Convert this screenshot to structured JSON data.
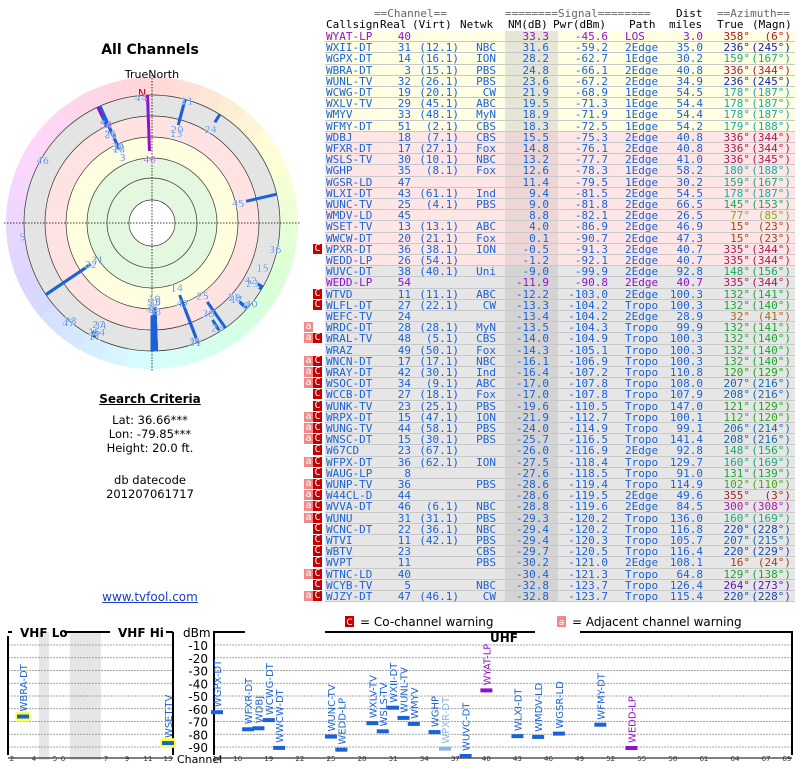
{
  "title": "All Channels",
  "polar": {
    "north_label": "TrueNorth",
    "n_marker": "N"
  },
  "search": {
    "title": "Search Criteria",
    "lat": "Lat: 36.66***",
    "lon": "Lon: -79.85***",
    "height": "Height: 20.0 ft.",
    "db_label": "db datecode",
    "db_code": "201207061717",
    "link": "www.tvfool.com"
  },
  "table": {
    "group_channel": "==Channel==",
    "group_signal": "========Signal========",
    "group_dist": "Dist",
    "group_azimuth": "==Azimuth==",
    "h_callsign": "Callsign",
    "h_real": "Real",
    "h_virt": "(Virt)",
    "h_netwk": "Netwk",
    "h_nm": "NM(dB)",
    "h_pwr": "Pwr(dBm)",
    "h_path": "Path",
    "h_dist": "miles",
    "h_true": "True",
    "h_magn": "(Magn)"
  },
  "colors": {
    "station": "#1a62d6",
    "highlight": "#9010d0",
    "cochannel": "#c40000",
    "adjacent": "#f08a8a"
  },
  "rows": [
    {
      "callsign": "WYAT-LP",
      "real": "40",
      "virt": "",
      "netwk": "",
      "nm": "33.3",
      "pwr": "-45.6",
      "path": "LOS",
      "dist": "3.0",
      "az_true": "358°",
      "az_magn": "(6°)",
      "warn": "",
      "color": "#9010d0"
    },
    {
      "callsign": "WXII-DT",
      "real": "31",
      "virt": "(12.1)",
      "netwk": "NBC",
      "nm": "31.6",
      "pwr": "-59.2",
      "path": "2Edge",
      "dist": "35.0",
      "az_true": "236°",
      "az_magn": "(245°)",
      "warn": ""
    },
    {
      "callsign": "WGPX-DT",
      "real": "14",
      "virt": "(16.1)",
      "netwk": "ION",
      "nm": "28.2",
      "pwr": "-62.7",
      "path": "1Edge",
      "dist": "30.2",
      "az_true": "159°",
      "az_magn": "(167°)",
      "warn": ""
    },
    {
      "callsign": "WBRA-DT",
      "real": "3",
      "virt": "(15.1)",
      "netwk": "PBS",
      "nm": "24.8",
      "pwr": "-66.1",
      "path": "2Edge",
      "dist": "40.8",
      "az_true": "336°",
      "az_magn": "(344°)",
      "warn": ""
    },
    {
      "callsign": "WUNL-TV",
      "real": "32",
      "virt": "(26.1)",
      "netwk": "PBS",
      "nm": "23.6",
      "pwr": "-67.2",
      "path": "2Edge",
      "dist": "34.9",
      "az_true": "236°",
      "az_magn": "(245°)",
      "warn": ""
    },
    {
      "callsign": "WCWG-DT",
      "real": "19",
      "virt": "(20.1)",
      "netwk": "CW",
      "nm": "21.9",
      "pwr": "-68.9",
      "path": "1Edge",
      "dist": "54.5",
      "az_true": "178°",
      "az_magn": "(187°)",
      "warn": ""
    },
    {
      "callsign": "WXLV-TV",
      "real": "29",
      "virt": "(45.1)",
      "netwk": "ABC",
      "nm": "19.5",
      "pwr": "-71.3",
      "path": "1Edge",
      "dist": "54.4",
      "az_true": "178°",
      "az_magn": "(187°)",
      "warn": ""
    },
    {
      "callsign": "WMYV",
      "real": "33",
      "virt": "(48.1)",
      "netwk": "MyN",
      "nm": "18.9",
      "pwr": "-71.9",
      "path": "1Edge",
      "dist": "54.4",
      "az_true": "178°",
      "az_magn": "(187°)",
      "warn": ""
    },
    {
      "callsign": "WFMY-DT",
      "real": "51",
      "virt": "(2.1)",
      "netwk": "CBS",
      "nm": "18.3",
      "pwr": "-72.5",
      "path": "1Edge",
      "dist": "54.2",
      "az_true": "179°",
      "az_magn": "(188°)",
      "warn": ""
    },
    {
      "callsign": "WDBJ",
      "real": "18",
      "virt": "(7.1)",
      "netwk": "CBS",
      "nm": "15.5",
      "pwr": "-75.3",
      "path": "2Edge",
      "dist": "40.8",
      "az_true": "336°",
      "az_magn": "(344°)",
      "warn": ""
    },
    {
      "callsign": "WFXR-DT",
      "real": "17",
      "virt": "(27.1)",
      "netwk": "Fox",
      "nm": "14.8",
      "pwr": "-76.1",
      "path": "2Edge",
      "dist": "40.8",
      "az_true": "336°",
      "az_magn": "(344°)",
      "warn": ""
    },
    {
      "callsign": "WSLS-TV",
      "real": "30",
      "virt": "(10.1)",
      "netwk": "NBC",
      "nm": "13.2",
      "pwr": "-77.7",
      "path": "2Edge",
      "dist": "41.0",
      "az_true": "336°",
      "az_magn": "(345°)",
      "warn": ""
    },
    {
      "callsign": "WGHP",
      "real": "35",
      "virt": "(8.1)",
      "netwk": "Fox",
      "nm": "12.6",
      "pwr": "-78.3",
      "path": "1Edge",
      "dist": "58.2",
      "az_true": "180°",
      "az_magn": "(188°)",
      "warn": ""
    },
    {
      "callsign": "WGSR-LD",
      "real": "47",
      "virt": "",
      "netwk": "",
      "nm": "11.4",
      "pwr": "-79.5",
      "path": "1Edge",
      "dist": "30.2",
      "az_true": "159°",
      "az_magn": "(167°)",
      "warn": ""
    },
    {
      "callsign": "WLXI-DT",
      "real": "43",
      "virt": "(61.1)",
      "netwk": "Ind",
      "nm": "9.4",
      "pwr": "-81.5",
      "path": "2Edge",
      "dist": "54.5",
      "az_true": "178°",
      "az_magn": "(187°)",
      "warn": ""
    },
    {
      "callsign": "WUNC-TV",
      "real": "25",
      "virt": "(4.1)",
      "netwk": "PBS",
      "nm": "9.0",
      "pwr": "-81.8",
      "path": "2Edge",
      "dist": "66.5",
      "az_true": "145°",
      "az_magn": "(153°)",
      "warn": ""
    },
    {
      "callsign": "WMDV-LD",
      "real": "45",
      "virt": "",
      "netwk": "",
      "nm": "8.8",
      "pwr": "-82.1",
      "path": "2Edge",
      "dist": "26.5",
      "az_true": "77°",
      "az_magn": "(85°)",
      "warn": ""
    },
    {
      "callsign": "WSET-TV",
      "real": "13",
      "virt": "(13.1)",
      "netwk": "ABC",
      "nm": "4.0",
      "pwr": "-86.9",
      "path": "2Edge",
      "dist": "46.9",
      "az_true": "15°",
      "az_magn": "(23°)",
      "warn": ""
    },
    {
      "callsign": "WWCW-DT",
      "real": "20",
      "virt": "(21.1)",
      "netwk": "Fox",
      "nm": "0.1",
      "pwr": "-90.7",
      "path": "2Edge",
      "dist": "47.3",
      "az_true": "15°",
      "az_magn": "(23°)",
      "warn": ""
    },
    {
      "callsign": "WPXR-DT",
      "real": "36",
      "virt": "(38.1)",
      "netwk": "ION",
      "nm": "-0.5",
      "pwr": "-91.3",
      "path": "2Edge",
      "dist": "40.7",
      "az_true": "335°",
      "az_magn": "(344°)",
      "warn": "C"
    },
    {
      "callsign": "WEDD-LP",
      "real": "26",
      "virt": "(54.1)",
      "netwk": "",
      "nm": "-1.2",
      "pwr": "-92.1",
      "path": "2Edge",
      "dist": "40.7",
      "az_true": "335°",
      "az_magn": "(344°)",
      "warn": ""
    },
    {
      "callsign": "WUVC-DT",
      "real": "38",
      "virt": "(40.1)",
      "netwk": "Uni",
      "nm": "-9.0",
      "pwr": "-99.9",
      "path": "2Edge",
      "dist": "92.8",
      "az_true": "148°",
      "az_magn": "(156°)",
      "warn": ""
    },
    {
      "callsign": "WEDD-LP",
      "real": "54",
      "virt": "",
      "netwk": "",
      "nm": "-11.9",
      "pwr": "-90.8",
      "path": "2Edge",
      "dist": "40.7",
      "az_true": "335°",
      "az_magn": "(344°)",
      "warn": "",
      "color": "#9010d0"
    },
    {
      "callsign": "WTVD",
      "real": "11",
      "virt": "(11.1)",
      "netwk": "ABC",
      "nm": "-12.2",
      "pwr": "-103.0",
      "path": "2Edge",
      "dist": "100.3",
      "az_true": "132°",
      "az_magn": "(141°)",
      "warn": "C"
    },
    {
      "callsign": "WLFL-DT",
      "real": "27",
      "virt": "(22.1)",
      "netwk": "CW",
      "nm": "-13.3",
      "pwr": "-104.2",
      "path": "Tropo",
      "dist": "100.3",
      "az_true": "132°",
      "az_magn": "(140°)",
      "warn": "C"
    },
    {
      "callsign": "WEFC-TV",
      "real": "24",
      "virt": "",
      "netwk": "",
      "nm": "-13.4",
      "pwr": "-104.2",
      "path": "2Edge",
      "dist": "28.9",
      "az_true": "32°",
      "az_magn": "(41°)",
      "warn": ""
    },
    {
      "callsign": "WRDC-DT",
      "real": "28",
      "virt": "(28.1)",
      "netwk": "MyN",
      "nm": "-13.5",
      "pwr": "-104.3",
      "path": "Tropo",
      "dist": "99.9",
      "az_true": "132°",
      "az_magn": "(141°)",
      "warn": "a"
    },
    {
      "callsign": "WRAL-TV",
      "real": "48",
      "virt": "(5.1)",
      "netwk": "CBS",
      "nm": "-14.0",
      "pwr": "-104.9",
      "path": "Tropo",
      "dist": "100.3",
      "az_true": "132°",
      "az_magn": "(140°)",
      "warn": "aC"
    },
    {
      "callsign": "WRAZ",
      "real": "49",
      "virt": "(50.1)",
      "netwk": "Fox",
      "nm": "-14.3",
      "pwr": "-105.1",
      "path": "Tropo",
      "dist": "100.3",
      "az_true": "132°",
      "az_magn": "(140°)",
      "warn": ""
    },
    {
      "callsign": "WNCN-DT",
      "real": "17",
      "virt": "(17.1)",
      "netwk": "NBC",
      "nm": "-16.1",
      "pwr": "-106.9",
      "path": "Tropo",
      "dist": "100.3",
      "az_true": "132°",
      "az_magn": "(140°)",
      "warn": "aC"
    },
    {
      "callsign": "WRAY-DT",
      "real": "42",
      "virt": "(30.1)",
      "netwk": "Ind",
      "nm": "-16.4",
      "pwr": "-107.2",
      "path": "Tropo",
      "dist": "110.8",
      "az_true": "120°",
      "az_magn": "(129°)",
      "warn": "aC"
    },
    {
      "callsign": "WSOC-DT",
      "real": "34",
      "virt": "(9.1)",
      "netwk": "ABC",
      "nm": "-17.0",
      "pwr": "-107.8",
      "path": "Tropo",
      "dist": "108.0",
      "az_true": "207°",
      "az_magn": "(216°)",
      "warn": "aC"
    },
    {
      "callsign": "WCCB-DT",
      "real": "27",
      "virt": "(18.1)",
      "netwk": "Fox",
      "nm": "-17.0",
      "pwr": "-107.8",
      "path": "Tropo",
      "dist": "107.9",
      "az_true": "208°",
      "az_magn": "(216°)",
      "warn": "C"
    },
    {
      "callsign": "WUNK-TV",
      "real": "23",
      "virt": "(25.1)",
      "netwk": "PBS",
      "nm": "-19.6",
      "pwr": "-110.5",
      "path": "Tropo",
      "dist": "147.0",
      "az_true": "121°",
      "az_magn": "(129°)",
      "warn": "C"
    },
    {
      "callsign": "WRPX-DT",
      "real": "15",
      "virt": "(47.1)",
      "netwk": "ION",
      "nm": "-21.9",
      "pwr": "-112.7",
      "path": "Tropo",
      "dist": "100.1",
      "az_true": "112°",
      "az_magn": "(120°)",
      "warn": "aC"
    },
    {
      "callsign": "WUNG-TV",
      "real": "44",
      "virt": "(58.1)",
      "netwk": "PBS",
      "nm": "-24.0",
      "pwr": "-114.9",
      "path": "Tropo",
      "dist": "99.1",
      "az_true": "206°",
      "az_magn": "(214°)",
      "warn": "aC"
    },
    {
      "callsign": "WNSC-DT",
      "real": "15",
      "virt": "(30.1)",
      "netwk": "PBS",
      "nm": "-25.7",
      "pwr": "-116.5",
      "path": "Tropo",
      "dist": "141.4",
      "az_true": "208°",
      "az_magn": "(216°)",
      "warn": "aC"
    },
    {
      "callsign": "W67CD",
      "real": "23",
      "virt": "(67.1)",
      "netwk": "",
      "nm": "-26.0",
      "pwr": "-116.9",
      "path": "2Edge",
      "dist": "92.8",
      "az_true": "148°",
      "az_magn": "(156°)",
      "warn": "C"
    },
    {
      "callsign": "WFPX-DT",
      "real": "36",
      "virt": "(62.1)",
      "netwk": "ION",
      "nm": "-27.5",
      "pwr": "-118.4",
      "path": "Tropo",
      "dist": "129.7",
      "az_true": "160°",
      "az_magn": "(169°)",
      "warn": "aC"
    },
    {
      "callsign": "WAUG-LP",
      "real": "8",
      "virt": "",
      "netwk": "",
      "nm": "-27.6",
      "pwr": "-118.5",
      "path": "Tropo",
      "dist": "91.0",
      "az_true": "131°",
      "az_magn": "(139°)",
      "warn": "C"
    },
    {
      "callsign": "WUNP-TV",
      "real": "36",
      "virt": "",
      "netwk": "PBS",
      "nm": "-28.6",
      "pwr": "-119.4",
      "path": "Tropo",
      "dist": "114.9",
      "az_true": "102°",
      "az_magn": "(110°)",
      "warn": "aC"
    },
    {
      "callsign": "W44CL-D",
      "real": "44",
      "virt": "",
      "netwk": "",
      "nm": "-28.6",
      "pwr": "-119.5",
      "path": "2Edge",
      "dist": "49.6",
      "az_true": "355°",
      "az_magn": "(3°)",
      "warn": "aC"
    },
    {
      "callsign": "WVVA-DT",
      "real": "46",
      "virt": "(6.1)",
      "netwk": "NBC",
      "nm": "-28.8",
      "pwr": "-119.6",
      "path": "2Edge",
      "dist": "84.5",
      "az_true": "300°",
      "az_magn": "(308°)",
      "warn": "aC"
    },
    {
      "callsign": "WUNU",
      "real": "31",
      "virt": "(31.1)",
      "netwk": "PBS",
      "nm": "-29.3",
      "pwr": "-120.2",
      "path": "Tropo",
      "dist": "136.0",
      "az_true": "160°",
      "az_magn": "(169°)",
      "warn": "aC"
    },
    {
      "callsign": "WCNC-DT",
      "real": "22",
      "virt": "(36.1)",
      "netwk": "NBC",
      "nm": "-29.4",
      "pwr": "-120.2",
      "path": "Tropo",
      "dist": "116.8",
      "az_true": "220°",
      "az_magn": "(228°)",
      "warn": "C"
    },
    {
      "callsign": "WTVI",
      "real": "11",
      "virt": "(42.1)",
      "netwk": "PBS",
      "nm": "-29.4",
      "pwr": "-120.3",
      "path": "Tropo",
      "dist": "105.7",
      "az_true": "207°",
      "az_magn": "(215°)",
      "warn": "C"
    },
    {
      "callsign": "WBTV",
      "real": "23",
      "virt": "",
      "netwk": "CBS",
      "nm": "-29.7",
      "pwr": "-120.5",
      "path": "Tropo",
      "dist": "116.4",
      "az_true": "220°",
      "az_magn": "(229°)",
      "warn": "C"
    },
    {
      "callsign": "WVPT",
      "real": "11",
      "virt": "",
      "netwk": "PBS",
      "nm": "-30.2",
      "pwr": "-121.0",
      "path": "2Edge",
      "dist": "108.1",
      "az_true": "16°",
      "az_magn": "(24°)",
      "warn": "C"
    },
    {
      "callsign": "WTNC-LD",
      "real": "40",
      "virt": "",
      "netwk": "",
      "nm": "-30.4",
      "pwr": "-121.3",
      "path": "Tropo",
      "dist": "64.8",
      "az_true": "129°",
      "az_magn": "(138°)",
      "warn": "aC"
    },
    {
      "callsign": "WCYB-TV",
      "real": "5",
      "virt": "",
      "netwk": "NBC",
      "nm": "-32.8",
      "pwr": "-123.7",
      "path": "Tropo",
      "dist": "126.4",
      "az_true": "264°",
      "az_magn": "(273°)",
      "warn": "C"
    },
    {
      "callsign": "WJZY-DT",
      "real": "47",
      "virt": "(46.1)",
      "netwk": "CW",
      "nm": "-32.8",
      "pwr": "-123.7",
      "path": "Tropo",
      "dist": "115.4",
      "az_true": "220°",
      "az_magn": "(228°)",
      "warn": "aC"
    }
  ],
  "legend": {
    "c_mark": "C",
    "c_text": "= Co-channel warning",
    "a_mark": "a",
    "a_text": "= Adjacent channel warning"
  },
  "spectrum": {
    "vhf_lo": "VHF Lo",
    "vhf_hi": "VHF Hi",
    "uhf": "UHF",
    "unit": "dBm",
    "channel_label": "Channel",
    "dbm_ticks": [
      "-10",
      "-20",
      "-30",
      "-40",
      "-50",
      "-60",
      "-70",
      "-80",
      "-90"
    ],
    "vhf_ticks": [
      "2",
      "4",
      "5",
      "6",
      "7",
      "9",
      "11",
      "13"
    ],
    "uhf_ticks": [
      "14",
      "16",
      "19",
      "22",
      "25",
      "28",
      "31",
      "34",
      "37",
      "40",
      "43",
      "46",
      "49",
      "52",
      "55",
      "58",
      "61",
      "64",
      "67",
      "69"
    ]
  }
}
